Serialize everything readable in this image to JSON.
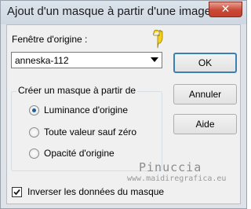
{
  "window": {
    "title": "Ajout d'un masque à partir d'une image",
    "close_glyph": "✕"
  },
  "source": {
    "label": "Fenêtre d'origine :",
    "selected": "anneska-112"
  },
  "buttons": {
    "ok": "OK",
    "cancel": "Annuler",
    "help": "Aide"
  },
  "group": {
    "title": "Créer un masque à partir de",
    "options": [
      {
        "label": "Luminance d'origine",
        "checked": true
      },
      {
        "label": "Toute valeur sauf zéro",
        "checked": false
      },
      {
        "label": "Opacité d'origine",
        "checked": false
      }
    ]
  },
  "invert": {
    "label": "Inverser les données du masque",
    "checked": true
  },
  "watermark": {
    "name": "Pinuccia",
    "url": "www.maidiregrafica.eu"
  },
  "icons": {
    "pointer": "pointing-hand-icon",
    "combo_arrow": "chevron-down-icon",
    "checkmark": "checkmark-icon"
  },
  "colors": {
    "accent": "#3c7fb1",
    "close": "#c94836",
    "pointer": "#f5d21a"
  }
}
